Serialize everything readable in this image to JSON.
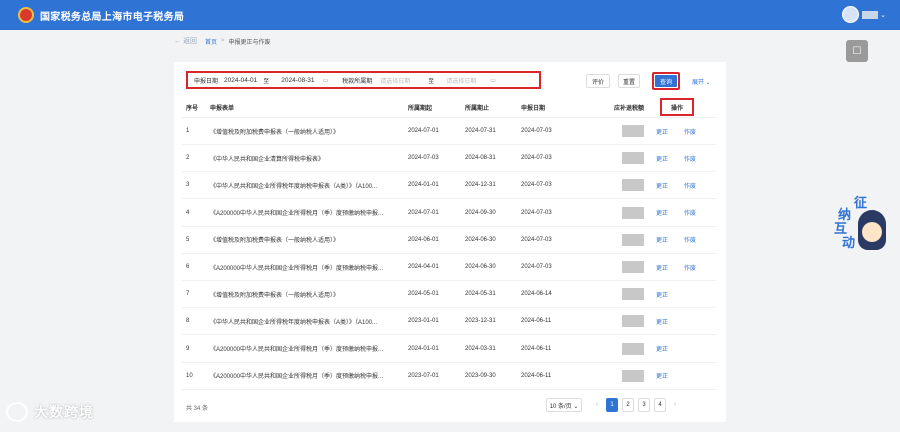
{
  "header": {
    "title": "国家税务总局上海市电子税务局"
  },
  "breadcrumb": {
    "back": "← 返回",
    "home": "首页",
    "separator": ">",
    "current": "申报更正与作废"
  },
  "filters": {
    "declare_date_label": "申报日期",
    "declare_date_start": "2024-04-01",
    "to_label": "至",
    "declare_date_end": "2024-08-31",
    "period_label": "税款所属期",
    "period_start_placeholder": "请选择日期",
    "period_end_placeholder": "请选择日期"
  },
  "buttons": {
    "reset": "评价",
    "clear": "重置",
    "query": "查询",
    "expand": "展开 ⌄"
  },
  "table": {
    "headers": {
      "index": "序号",
      "form": "申报表单",
      "period_start": "所属期起",
      "period_end": "所属期止",
      "declare_date": "申报日期",
      "amount": "应补退税额",
      "operation": "操作"
    },
    "rows": [
      {
        "index": "1",
        "form": "《增值税及附加税费申报表（一般纳税人适用）》",
        "start": "2024-07-01",
        "end": "2024-07-31",
        "date": "2024-07-03",
        "act1": "更正",
        "act2": "作废"
      },
      {
        "index": "2",
        "form": "《中华人民共和国企业清算所得税申报表》",
        "start": "2024-07-03",
        "end": "2024-08-31",
        "date": "2024-07-03",
        "act1": "更正",
        "act2": "作废"
      },
      {
        "index": "3",
        "form": "《中华人民共和国企业所得税年度纳税申报表（A类）》（A100...",
        "start": "2024-01-01",
        "end": "2024-12-31",
        "date": "2024-07-03",
        "act1": "更正",
        "act2": "作废"
      },
      {
        "index": "4",
        "form": "《A200000中华人民共和国企业所得税月（季）度预缴纳税申报...",
        "start": "2024-07-01",
        "end": "2024-09-30",
        "date": "2024-07-03",
        "act1": "更正",
        "act2": "作废"
      },
      {
        "index": "5",
        "form": "《增值税及附加税费申报表（一般纳税人适用）》",
        "start": "2024-06-01",
        "end": "2024-06-30",
        "date": "2024-07-03",
        "act1": "更正",
        "act2": "作废"
      },
      {
        "index": "6",
        "form": "《A200000中华人民共和国企业所得税月（季）度预缴纳税申报...",
        "start": "2024-04-01",
        "end": "2024-06-30",
        "date": "2024-07-03",
        "act1": "更正",
        "act2": "作废"
      },
      {
        "index": "7",
        "form": "《增值税及附加税费申报表（一般纳税人适用）》",
        "start": "2024-05-01",
        "end": "2024-05-31",
        "date": "2024-06-14",
        "act1": "更正",
        "act2": ""
      },
      {
        "index": "8",
        "form": "《中华人民共和国企业所得税年度纳税申报表（A类）》（A100...",
        "start": "2023-01-01",
        "end": "2023-12-31",
        "date": "2024-06-11",
        "act1": "更正",
        "act2": ""
      },
      {
        "index": "9",
        "form": "《A200000中华人民共和国企业所得税月（季）度预缴纳税申报...",
        "start": "2024-01-01",
        "end": "2024-03-31",
        "date": "2024-06-11",
        "act1": "更正",
        "act2": ""
      },
      {
        "index": "10",
        "form": "《A200000中华人民共和国企业所得税月（季）度预缴纳税申报...",
        "start": "2023-07-01",
        "end": "2023-09-30",
        "date": "2024-06-11",
        "act1": "更正",
        "act2": ""
      }
    ]
  },
  "pagination": {
    "total": "共 34 条",
    "page_size": "10 条/页 ⌄",
    "prev": "‹",
    "next": "›",
    "pages": [
      "1",
      "2",
      "3",
      "4"
    ]
  },
  "mascot": {
    "chars": [
      "征",
      "纳",
      "互",
      "动"
    ]
  },
  "watermark": {
    "text": "大数跨境"
  }
}
